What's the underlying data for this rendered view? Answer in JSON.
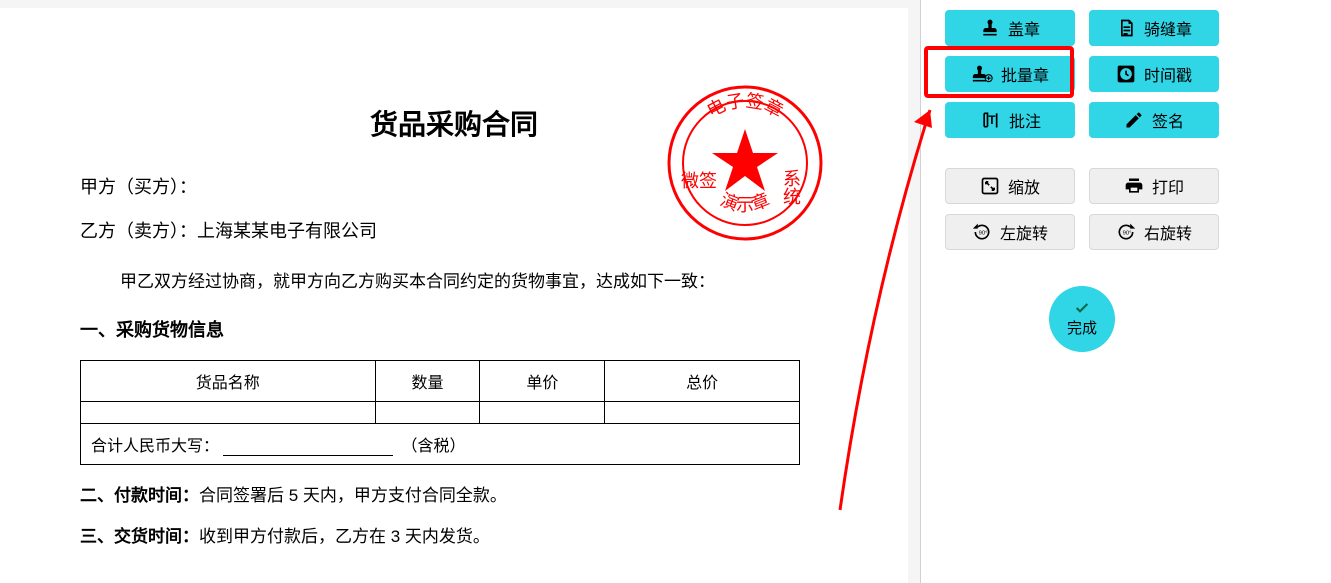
{
  "document": {
    "title": "货品采购合同",
    "party_a": "甲方（买方）：",
    "party_b_label": "乙方（卖方）：",
    "party_b_value": "上海某某电子有限公司",
    "intro": "甲乙双方经过协商，就甲方向乙方购买本合同约定的货物事宜，达成如下一致：",
    "section1": "一、采购货物信息",
    "table_headers": [
      "货品名称",
      "数量",
      "单价",
      "总价"
    ],
    "total_prefix": "合计人民币大写：",
    "total_suffix": "（含税）",
    "section2_label": "二、付款时间：",
    "section2_text": "合同签署后 5 天内，甲方支付合同全款。",
    "section3_label": "三、交货时间：",
    "section3_text": "收到甲方付款后，乙方在 3 天内发货。"
  },
  "stamp": {
    "outer_top": "电子签章",
    "outer_left": "微签",
    "outer_right": "系统",
    "outer_bottom": "演示章"
  },
  "toolbar": {
    "stamp": "盖章",
    "straddle": "骑缝章",
    "batch": "批量章",
    "timestamp": "时间戳",
    "annotate": "批注",
    "sign": "签名",
    "zoom": "缩放",
    "print": "打印",
    "rotate_left": "左旋转",
    "rotate_right": "右旋转",
    "done": "完成"
  }
}
